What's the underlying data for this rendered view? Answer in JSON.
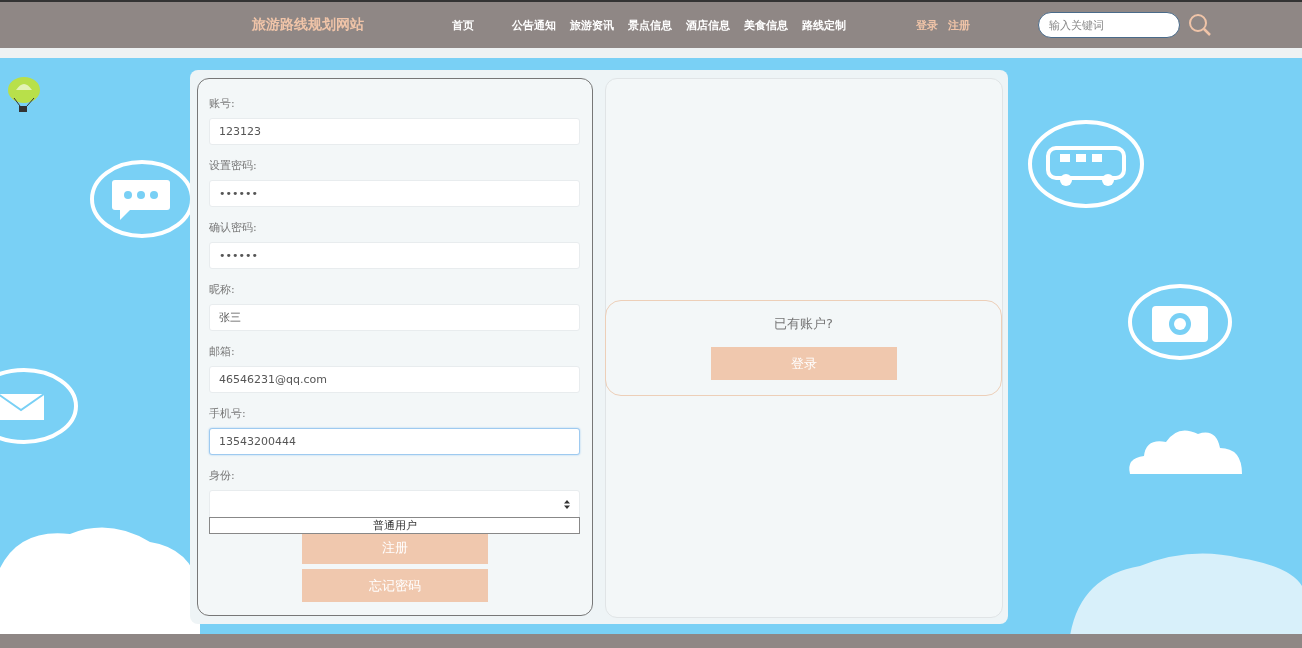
{
  "header": {
    "site_title": "旅游路线规划网站",
    "nav": [
      {
        "label": "首页"
      },
      {
        "label": "公告通知"
      },
      {
        "label": "旅游资讯"
      },
      {
        "label": "景点信息"
      },
      {
        "label": "酒店信息"
      },
      {
        "label": "美食信息"
      },
      {
        "label": "路线定制"
      }
    ],
    "auth_links": [
      {
        "label": "登录"
      },
      {
        "label": "注册"
      }
    ],
    "search": {
      "placeholder": "输入关键词"
    }
  },
  "register_form": {
    "fields": [
      {
        "label": "账号:",
        "value": "123123",
        "focused": false
      },
      {
        "label": "设置密码:",
        "value": "••••••",
        "focused": false
      },
      {
        "label": "确认密码:",
        "value": "••••••",
        "focused": false
      },
      {
        "label": "昵称:",
        "value": "张三",
        "focused": false
      },
      {
        "label": "邮箱:",
        "value": "46546231@qq.com",
        "focused": false
      },
      {
        "label": "手机号:",
        "value": "13543200444",
        "focused": true
      }
    ],
    "role_select": {
      "label": "身份:",
      "dropdown_options": [
        "普通用户"
      ]
    },
    "buttons": [
      "注册",
      "忘记密码"
    ]
  },
  "login_panel": {
    "prompt": "已有账户?",
    "button": "登录"
  }
}
